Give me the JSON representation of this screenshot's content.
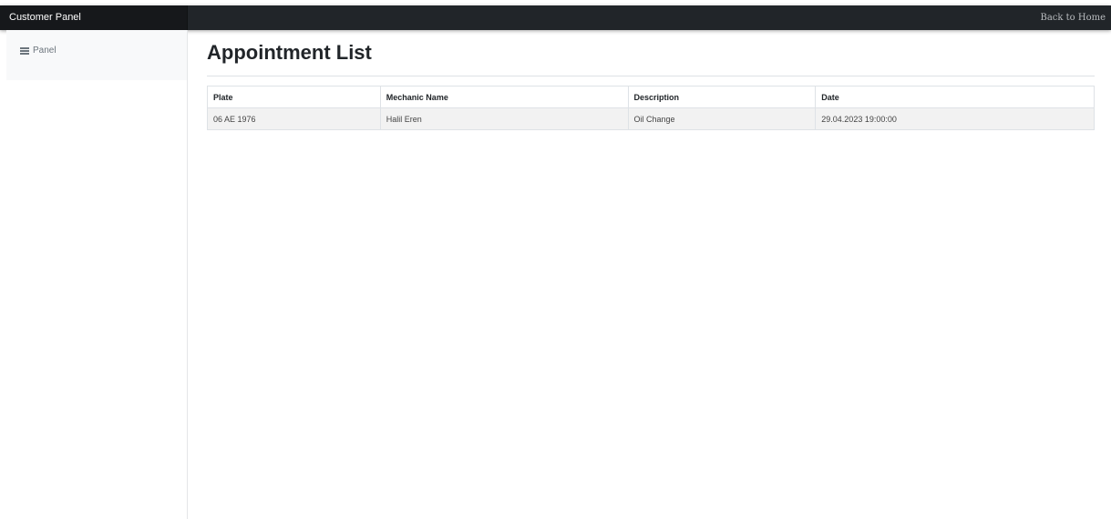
{
  "navbar": {
    "brand": "Customer Panel",
    "back_link": "Back to Home"
  },
  "sidebar": {
    "items": [
      {
        "label": "Panel",
        "icon": "bars-icon"
      }
    ]
  },
  "main": {
    "title": "Appointment List",
    "table": {
      "headers": [
        "Plate",
        "Mechanic Name",
        "Description",
        "Date"
      ],
      "rows": [
        [
          "06 AE 1976",
          "Halil Eren",
          "Oil Change",
          "29.04.2023 19:00:00"
        ]
      ]
    }
  },
  "colors": {
    "navbar_bg": "#212529",
    "brand_bg": "#16181b",
    "sidebar_bg": "#f8f9fa",
    "row_bg": "#f2f2f2",
    "border": "#dee2e6"
  }
}
